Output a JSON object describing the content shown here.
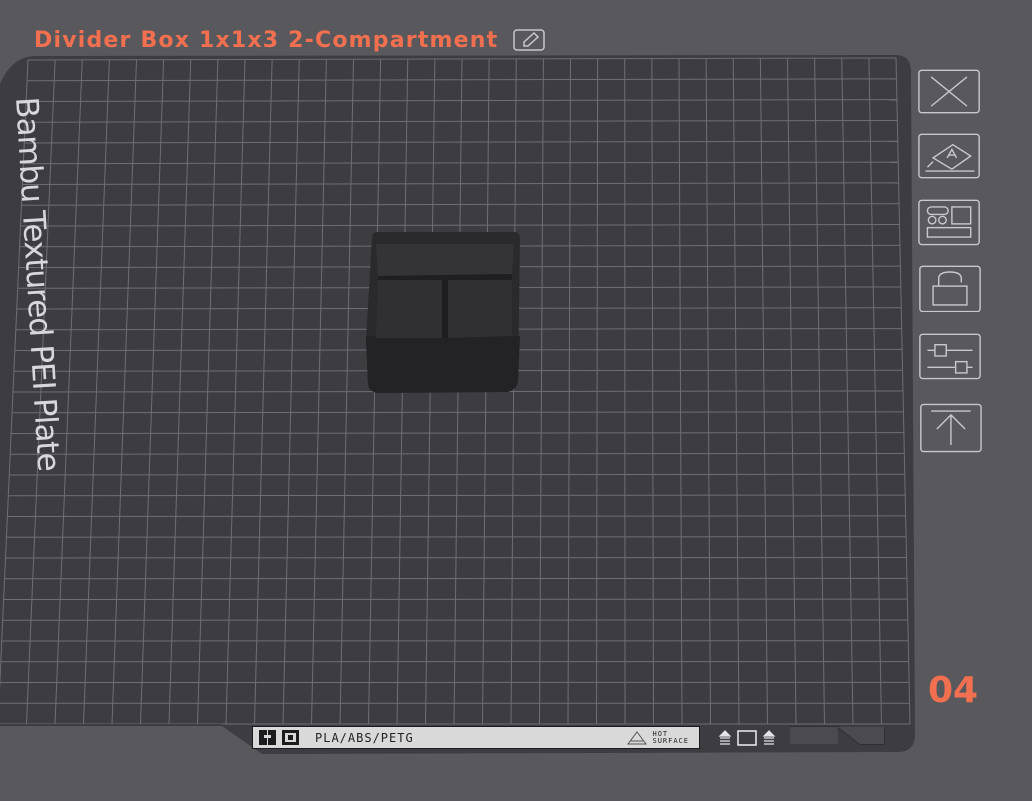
{
  "plate": {
    "title": "Divider Box 1x1x3 2-Compartment",
    "label": "Bambu Textured PEI Plate",
    "number": "04",
    "material": "PLA/ABS/PETG",
    "hot_surface": [
      "HOT",
      "SURFACE"
    ]
  },
  "toolbar": {
    "buttons": [
      {
        "name": "delete-plate",
        "icon": "close-icon"
      },
      {
        "name": "auto-orient",
        "icon": "auto-orient-icon"
      },
      {
        "name": "arrange",
        "icon": "arrange-icon"
      },
      {
        "name": "lock",
        "icon": "lock-icon"
      },
      {
        "name": "plate-settings",
        "icon": "settings-sliders-icon"
      },
      {
        "name": "move-to-top",
        "icon": "move-up-icon"
      }
    ]
  },
  "colors": {
    "accent": "#f2704f",
    "background": "#58585d",
    "bed": "#3b3b40",
    "grid": "#707076",
    "model": "#2b2b2d"
  }
}
